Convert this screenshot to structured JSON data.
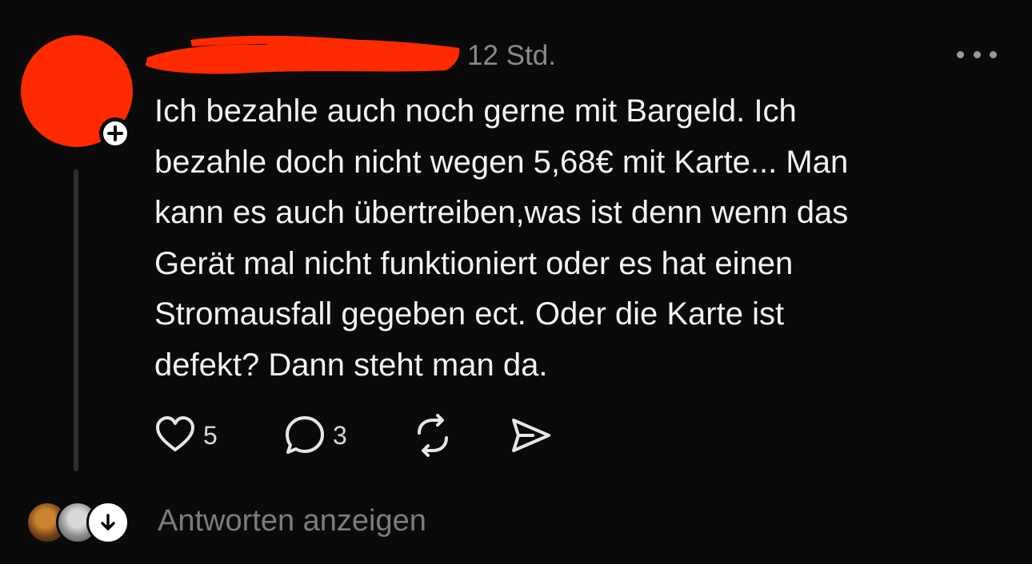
{
  "post": {
    "timestamp": "12 Std.",
    "text": "Ich bezahle auch noch gerne mit Bargeld. Ich\nbezahle doch nicht wegen 5,68€ mit Karte... Man\nkann es auch übertreiben,was ist denn wenn das\nGerät mal nicht funktioniert oder es hat einen\nStromausfall gegeben ect. Oder die Karte ist\ndefekt? Dann steht man da.",
    "avatar_color": "#ff2a00",
    "redaction_color": "#ff2a00"
  },
  "actions": {
    "like": {
      "icon": "heart-icon",
      "count": "5"
    },
    "reply": {
      "icon": "speech-bubble-icon",
      "count": "3"
    },
    "repost": {
      "icon": "repost-icon"
    },
    "share": {
      "icon": "send-icon"
    }
  },
  "replies": {
    "label": "Antworten anzeigen"
  }
}
